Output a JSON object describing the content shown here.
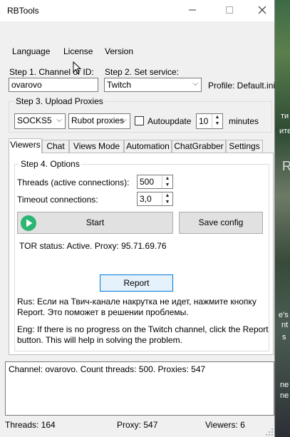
{
  "window": {
    "title": "RBTools"
  },
  "menu": [
    "Language",
    "License",
    "Version"
  ],
  "step1": {
    "label": "Step 1. Channel or ID:",
    "value": "ovarovo"
  },
  "step2": {
    "label": "Step 2. Set service:",
    "value": "Twitch",
    "profile": "Profile: Default.ini"
  },
  "step3": {
    "title": "Step 3. Upload Proxies",
    "proxy_type": "SOCKS5",
    "proxy_source": "Rubot proxies",
    "autoupdate_label": "Autoupdate",
    "autoupdate_checked": false,
    "minutes_value": "10",
    "minutes_label": "minutes"
  },
  "tabs": [
    "Viewers",
    "Chat",
    "Views Mode",
    "Automation",
    "ChatGrabber",
    "Settings"
  ],
  "active_tab": "Viewers",
  "step4": {
    "title": "Step 4. Options",
    "threads_label": "Threads (active connections):",
    "threads_value": "500",
    "timeout_label": "Timeout connections:",
    "timeout_value": "3,0",
    "start_label": "Start",
    "save_label": "Save config",
    "tor_status": "TOR status: Active. Proxy: 95.71.69.76",
    "report_label": "Report",
    "rus_notice": "Rus: Если на Твич-канале накрутка не идет, нажмите кнопку Report. Это поможет в решении проблемы.",
    "eng_notice": "Eng: If there is no progress on the Twitch channel, click the Report button. This will help in solving the problem."
  },
  "log": "Channel: ovarovo. Count threads: 500. Proxies: 547",
  "status": {
    "threads": "Threads: 164",
    "proxy": "Proxy: 547",
    "viewers": "Viewers: 6"
  },
  "background_fragments": [
    "ти",
    "ите",
    "R",
    "e's",
    "nt",
    "s",
    "ne",
    "ne"
  ],
  "colors": {
    "start_icon": "#2bb673",
    "window_bg": "#f0f0f0",
    "focus_border": "#0078d7"
  }
}
